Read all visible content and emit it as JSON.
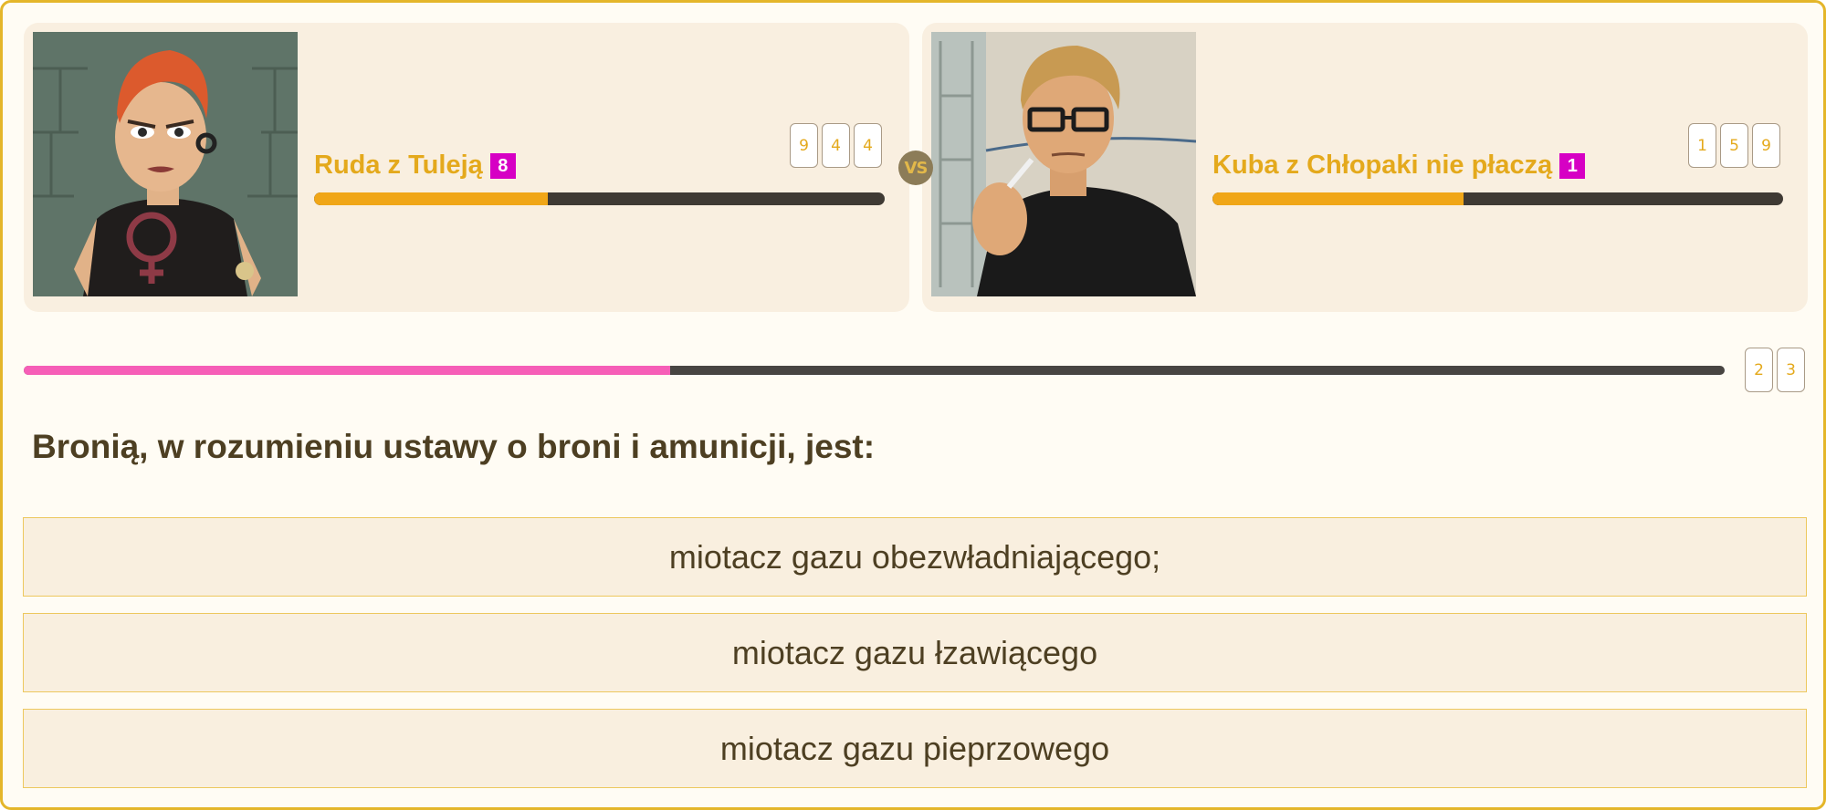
{
  "players": [
    {
      "name": "Ruda z Tuleją",
      "level": "8",
      "score_digits": [
        "9",
        "4",
        "4"
      ],
      "progress": 0.41,
      "avatar_icon": "punk-woman-avatar"
    },
    {
      "name": "Kuba z Chłopaki nie płaczą",
      "level": "1",
      "score_digits": [
        "1",
        "5",
        "9"
      ],
      "progress": 0.44,
      "avatar_icon": "man-with-glasses-avatar"
    }
  ],
  "vs_label": "VS",
  "round": {
    "progress": 0.38,
    "counter_digits": [
      "2",
      "3"
    ]
  },
  "question": "Bronią, w rozumieniu ustawy o broni i amunicji, jest:",
  "answers": [
    "miotacz gazu obezwładniającego;",
    "miotacz gazu łzawiącego",
    "miotacz gazu pieprzowego"
  ],
  "colors": {
    "accent": "#e4b62a",
    "player_name": "#e4a91c",
    "level_badge": "#d600c4",
    "player_bar_fill": "#f0a618",
    "round_bar_fill": "#f65eb7",
    "text": "#4d3f22"
  }
}
